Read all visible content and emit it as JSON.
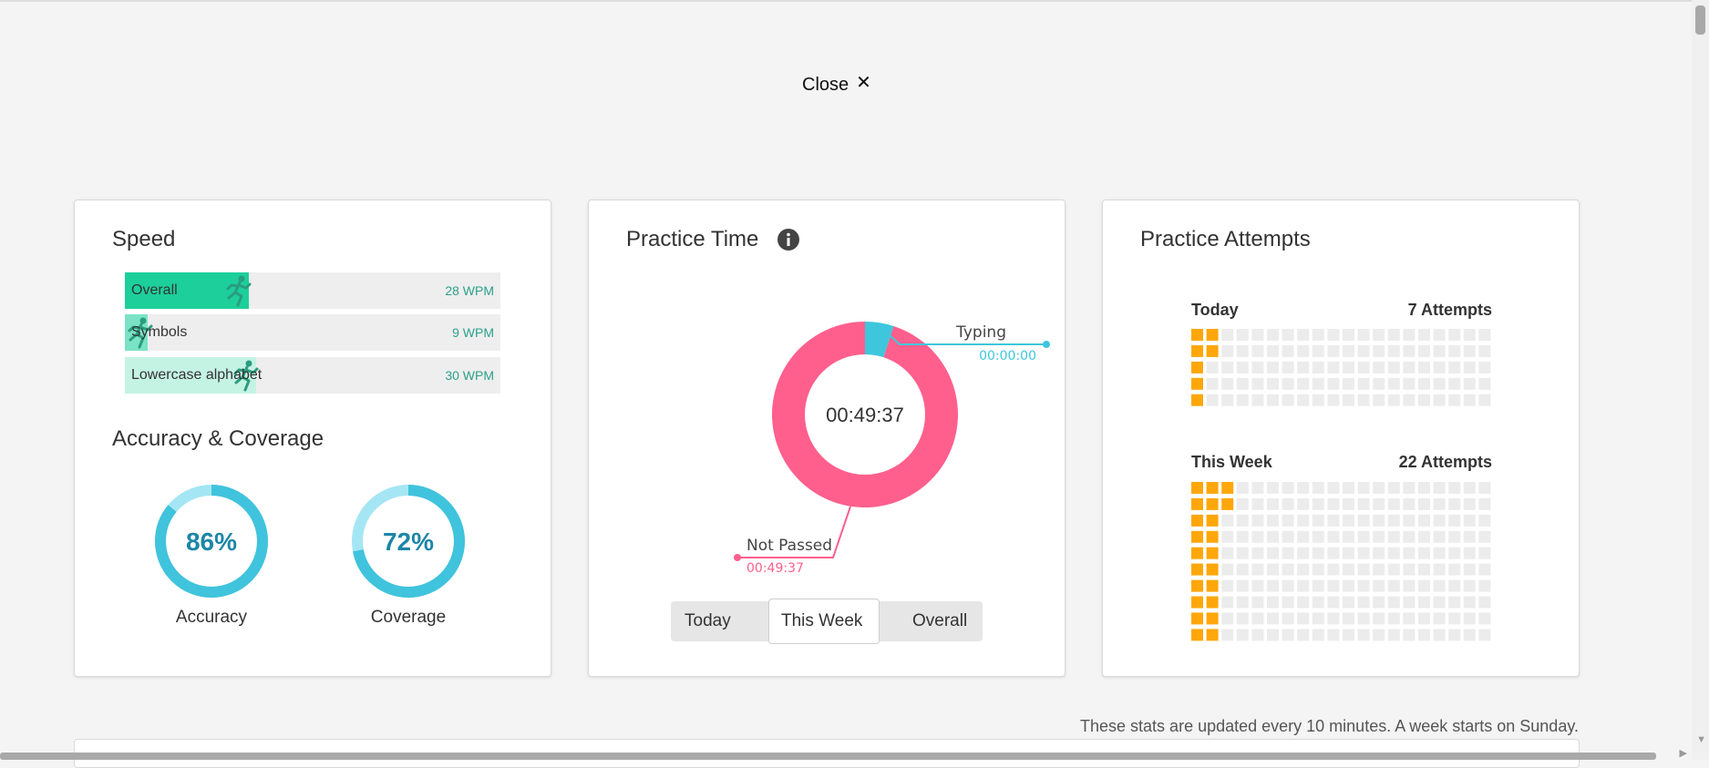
{
  "close": {
    "label": "Close",
    "icon": "close-icon"
  },
  "speed": {
    "title": "Speed",
    "bars": [
      {
        "label": "Overall",
        "wpm": "28 WPM",
        "fraction": 0.33,
        "color": "#1ccf9b"
      },
      {
        "label": "Symbols",
        "wpm": "9 WPM",
        "fraction": 0.06,
        "color": "#7be3c5"
      },
      {
        "label": "Lowercase alphabet",
        "wpm": "30 WPM",
        "fraction": 0.35,
        "color": "#c4f3e4"
      }
    ]
  },
  "accuracy": {
    "title": "Accuracy & Coverage",
    "accuracy_value": "86%",
    "accuracy_label": "Accuracy",
    "accuracy_fraction": 0.86,
    "coverage_value": "72%",
    "coverage_label": "Coverage",
    "coverage_fraction": 0.72
  },
  "practice_time": {
    "title": "Practice Time",
    "info_icon": "info-icon",
    "center_time": "00:49:37",
    "typing_label": "Typing",
    "typing_time": "00:00:00",
    "not_passed_label": "Not Passed",
    "not_passed_time": "00:49:37",
    "typing_fraction": 0.05,
    "colors": {
      "typing": "#3ec6dc",
      "not_passed": "#ff5f8d"
    },
    "tabs": [
      "Today",
      "This Week",
      "Overall"
    ],
    "active_tab": "This Week"
  },
  "attempts": {
    "title": "Practice Attempts",
    "today_label": "Today",
    "today_count": "7 Attempts",
    "today_filled": 7,
    "week_label": "This Week",
    "week_count": "22 Attempts",
    "week_filled": 22,
    "fill_color": "#ffa70a"
  },
  "footnote": "These stats are updated every 10 minutes. A week starts on Sunday."
}
